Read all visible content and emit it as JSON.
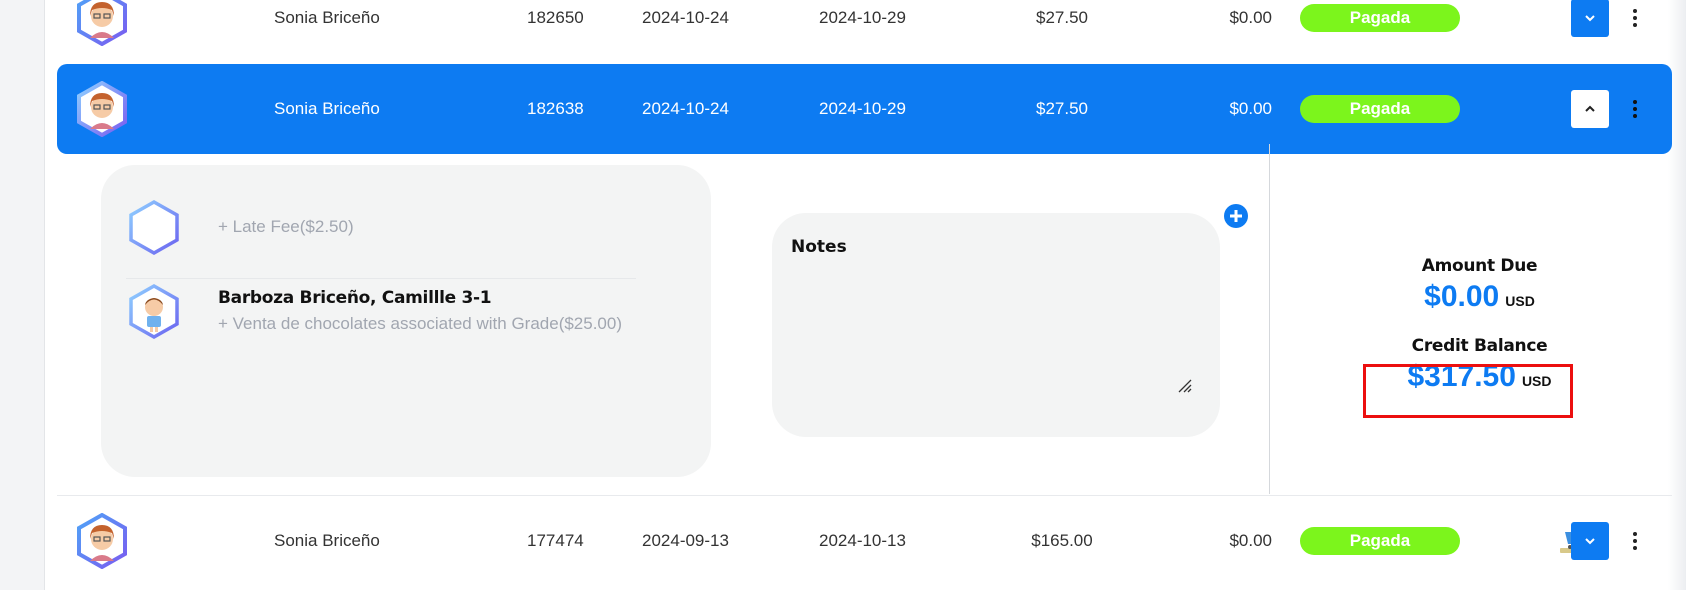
{
  "invoices": [
    {
      "customer": "Sonia Briceño",
      "number": "182650",
      "issued": "2024-10-24",
      "due": "2024-10-29",
      "amount": "$27.50",
      "balance": "$0.00",
      "status": "Pagada"
    },
    {
      "customer": "Sonia Briceño",
      "number": "182638",
      "issued": "2024-10-24",
      "due": "2024-10-29",
      "amount": "$27.50",
      "balance": "$0.00",
      "status": "Pagada"
    },
    {
      "customer": "Sonia Briceño",
      "number": "177474",
      "issued": "2024-09-13",
      "due": "2024-10-13",
      "amount": "$165.00",
      "balance": "$0.00",
      "status": "Pagada"
    }
  ],
  "details": {
    "line_items": [
      {
        "title": "",
        "description": "+ Late Fee($2.50)"
      },
      {
        "title": "Barboza Briceño, Camillle 3-1",
        "description": "+ Venta de chocolates associated with Grade($25.00)"
      }
    ],
    "notes": {
      "label": "Notes",
      "value": ""
    },
    "amount_due": {
      "label": "Amount Due",
      "value": "$0.00",
      "currency": "USD"
    },
    "credit_balance": {
      "label": "Credit Balance",
      "value": "$317.50",
      "currency": "USD"
    }
  },
  "colors": {
    "primary": "#0d7bf2",
    "status_paid": "#7cf51c",
    "highlight": "#ec0f0f"
  },
  "icons": {
    "avatar": "teacher-avatar-icon",
    "student": "student-avatar-icon",
    "expand": "chevron-down-icon",
    "collapse": "chevron-up-icon",
    "more": "kebab-menu-icon",
    "add": "plus-circle-icon",
    "cart": "shopping-cart-icon"
  }
}
